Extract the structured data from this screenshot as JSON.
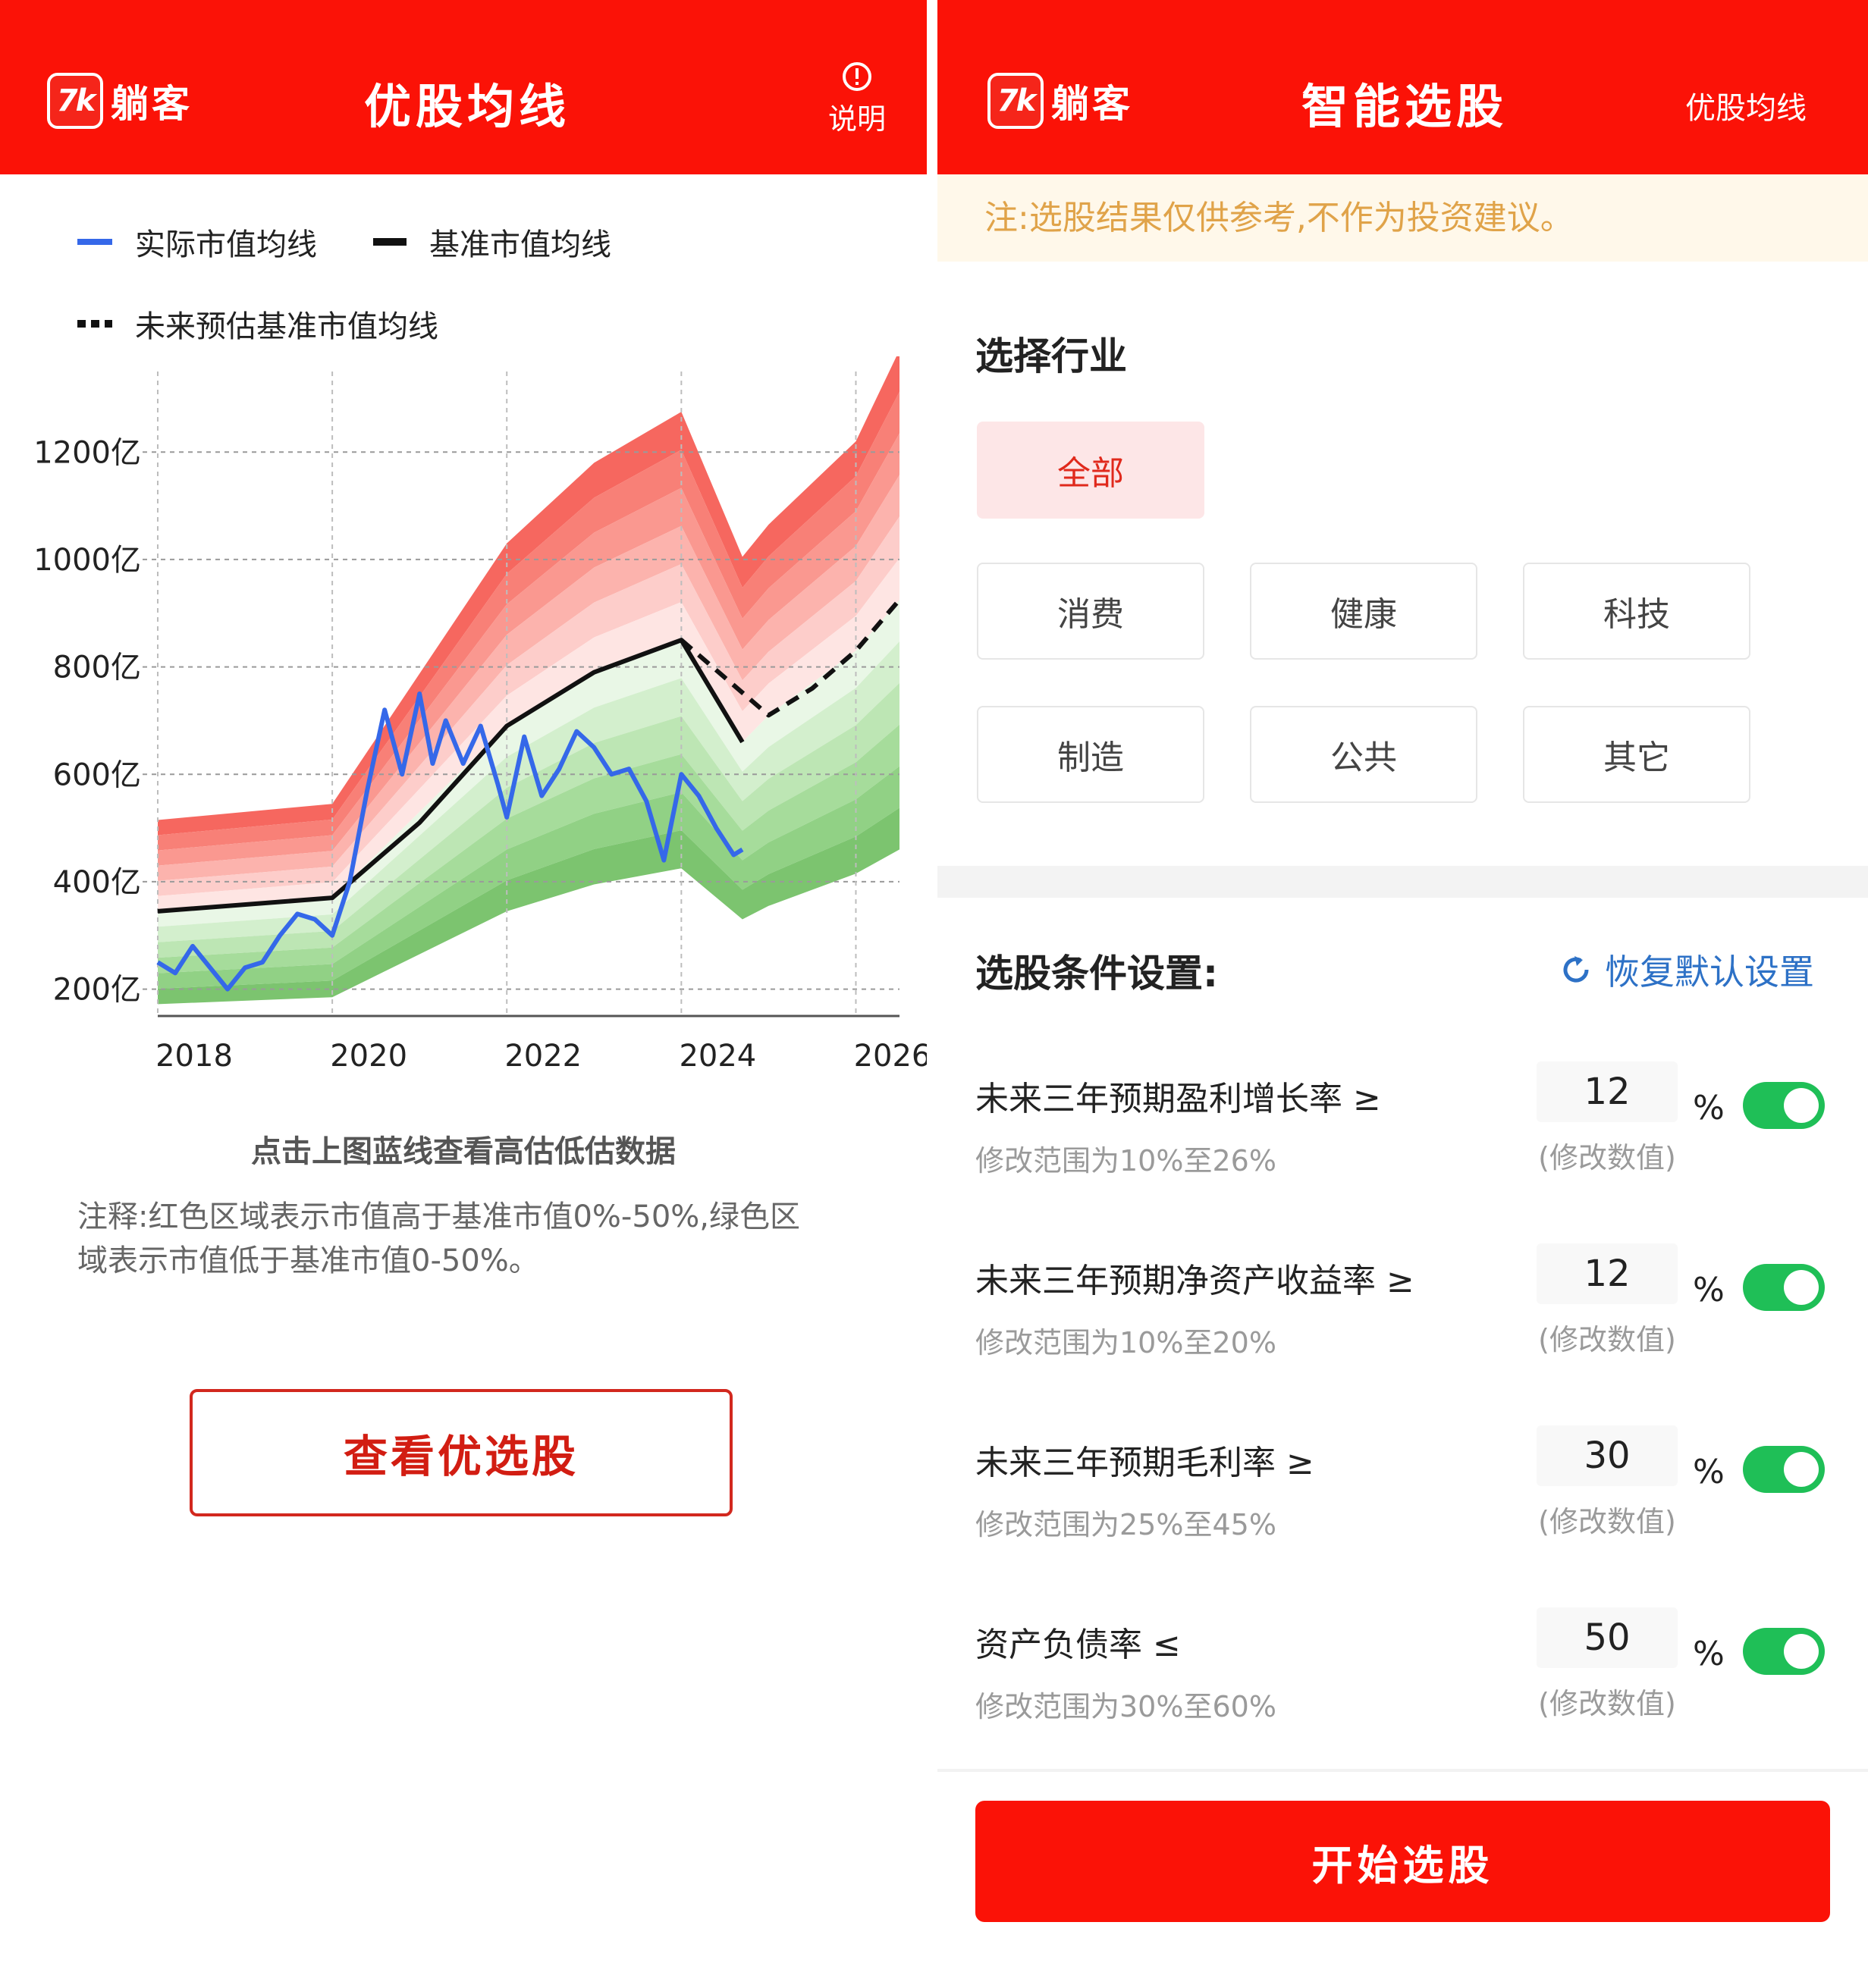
{
  "left": {
    "header": {
      "logo_mark": "7k",
      "logo_text": "躺客",
      "title": "优股均线",
      "help_label": "说明"
    },
    "legend": {
      "actual": "实际市值均线",
      "base": "基准市值均线",
      "future": "未来预估基准市值均线"
    },
    "chart_data": {
      "type": "line",
      "ylim": [
        150,
        1350
      ],
      "xlim": [
        2018,
        2026.5
      ],
      "y_ticks": [
        200,
        400,
        600,
        800,
        1000,
        1200
      ],
      "y_tick_labels": [
        "200亿",
        "400亿",
        "600亿",
        "800亿",
        "1000亿",
        "1200亿"
      ],
      "x_ticks": [
        2018,
        2020,
        2022,
        2024,
        2026
      ],
      "x_tick_labels": [
        "2018",
        "2020",
        "2022",
        "2024",
        "2026"
      ],
      "grid": true,
      "legend_position": "top-left",
      "colors": {
        "actual": "#3568e9",
        "base": "#111111",
        "future": "#111111",
        "red_band": "#f5615a",
        "green_band": "#7cc46f"
      },
      "series": [
        {
          "name": "基准市值均线",
          "style": "solid",
          "x": [
            2018,
            2020,
            2021,
            2022,
            2023,
            2024,
            2024.7
          ],
          "y": [
            345,
            370,
            510,
            690,
            790,
            850,
            660
          ]
        },
        {
          "name": "未来预估基准市值均线",
          "style": "dashed",
          "x": [
            2024,
            2025,
            2025.5,
            2026,
            2026.5
          ],
          "y": [
            850,
            710,
            760,
            830,
            925
          ]
        },
        {
          "name": "实际市值均线",
          "style": "solid",
          "x": [
            2018,
            2018.2,
            2018.4,
            2018.6,
            2018.8,
            2019.0,
            2019.2,
            2019.4,
            2019.6,
            2019.8,
            2020.0,
            2020.2,
            2020.4,
            2020.6,
            2020.8,
            2021.0,
            2021.15,
            2021.3,
            2021.5,
            2021.7,
            2021.9,
            2022.0,
            2022.2,
            2022.4,
            2022.6,
            2022.8,
            2023.0,
            2023.2,
            2023.4,
            2023.6,
            2023.8,
            2024.0,
            2024.2,
            2024.4,
            2024.6,
            2024.7
          ],
          "y": [
            250,
            230,
            280,
            240,
            200,
            240,
            250,
            300,
            340,
            330,
            300,
            400,
            570,
            720,
            600,
            750,
            620,
            700,
            620,
            690,
            580,
            520,
            670,
            560,
            610,
            680,
            650,
            600,
            610,
            550,
            440,
            600,
            560,
            500,
            450,
            460
          ]
        }
      ],
      "bands": {
        "x": [
          2018,
          2020,
          2022,
          2023,
          2024,
          2024.7,
          2025,
          2026,
          2026.5
        ],
        "upper_red": [
          515,
          545,
          1030,
          1180,
          1275,
          1005,
          1065,
          1220,
          1390
        ],
        "base": [
          345,
          370,
          690,
          790,
          850,
          660,
          710,
          830,
          925
        ],
        "lower_green": [
          172,
          185,
          345,
          395,
          425,
          330,
          355,
          415,
          460
        ]
      }
    },
    "hint": "点击上图蓝线查看高估低估数据",
    "note_line1": "注释:红色区域表示市值高于基准市值0%-50%,绿色区",
    "note_line2": "域表示市值低于基准市值0-50%。",
    "view_button": "查看优选股"
  },
  "right": {
    "header": {
      "logo_mark": "7k",
      "logo_text": "躺客",
      "title": "智能选股",
      "link_label": "优股均线"
    },
    "notice": "注:选股结果仅供参考,不作为投资建议。",
    "industry_title": "选择行业",
    "industries": [
      "全部",
      "消费",
      "健康",
      "科技",
      "制造",
      "公共",
      "其它"
    ],
    "industry_selected": "全部",
    "conditions_title": "选股条件设置:",
    "reset_label": "恢复默认设置",
    "conditions": [
      {
        "label": "未来三年预期盈利增长率 ≥",
        "range": "修改范围为10%至26%",
        "value": "12",
        "hint": "(修改数值)",
        "unit": "%",
        "enabled": true
      },
      {
        "label": "未来三年预期净资产收益率 ≥",
        "range": "修改范围为10%至20%",
        "value": "12",
        "hint": "(修改数值)",
        "unit": "%",
        "enabled": true
      },
      {
        "label": "未来三年预期毛利率 ≥",
        "range": "修改范围为25%至45%",
        "value": "30",
        "hint": "(修改数值)",
        "unit": "%",
        "enabled": true
      },
      {
        "label": "资产负债率 ≤",
        "range": "修改范围为30%至60%",
        "value": "50",
        "hint": "(修改数值)",
        "unit": "%",
        "enabled": true
      }
    ],
    "start_button": "开始选股"
  }
}
